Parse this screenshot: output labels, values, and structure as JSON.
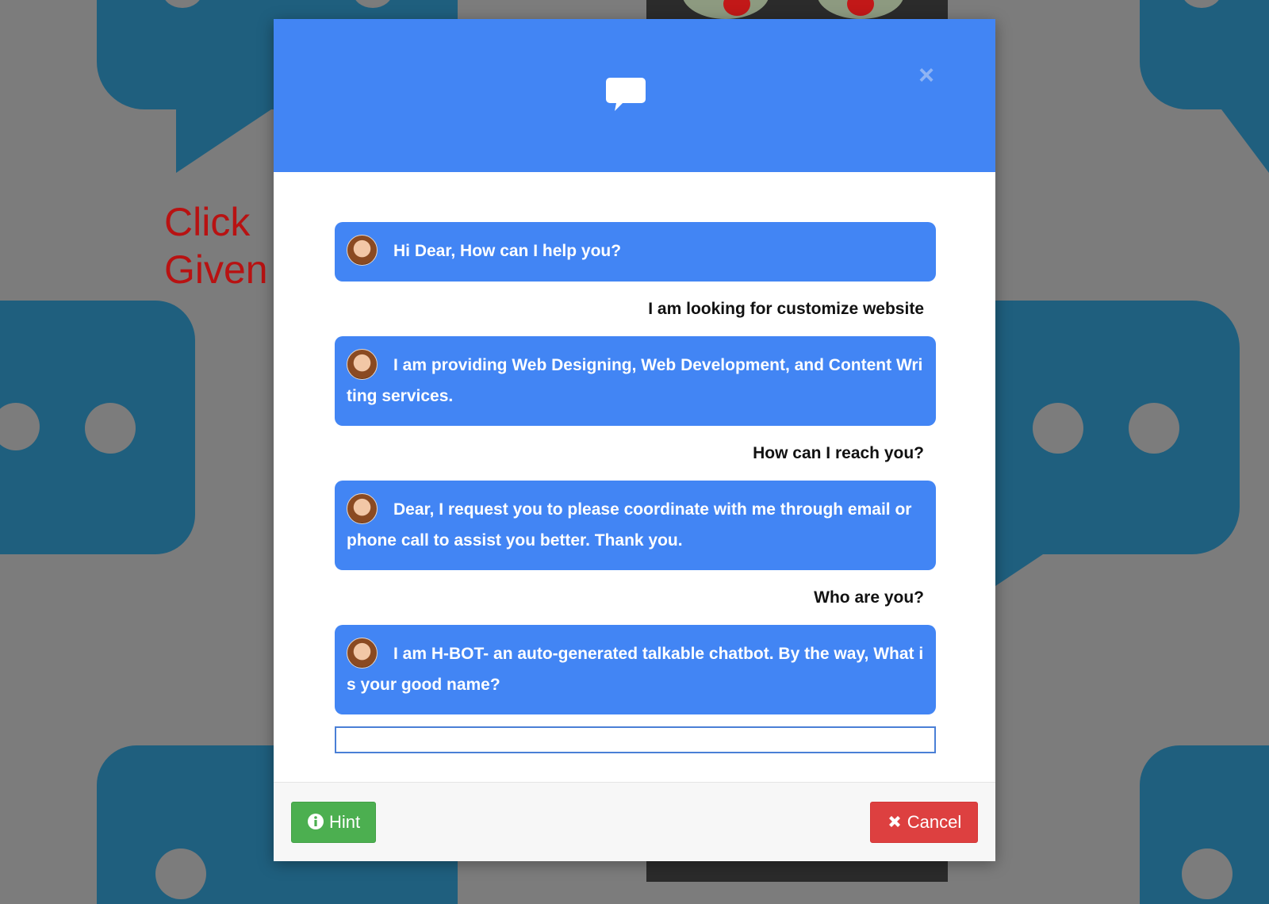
{
  "background": {
    "text": "Click \nGiven"
  },
  "header": {
    "icon": "chat-bubble-icon",
    "close_label": "×"
  },
  "messages": [
    {
      "sender": "bot",
      "text": "Hi Dear, How can I help you?"
    },
    {
      "sender": "user",
      "text": "I am looking for customize website"
    },
    {
      "sender": "bot",
      "text": "I am providing Web Designing, Web Development, and Content Writing services."
    },
    {
      "sender": "user",
      "text": "How can I reach you?"
    },
    {
      "sender": "bot",
      "text": "Dear, I request you to please coordinate with me through email or phone call to assist you better. Thank you."
    },
    {
      "sender": "user",
      "text": "Who are you?"
    },
    {
      "sender": "bot",
      "text": "I am H-BOT- an auto-generated talkable chatbot. By the way, What is your good name?"
    }
  ],
  "input": {
    "value": "",
    "placeholder": ""
  },
  "footer": {
    "hint_label": "Hint",
    "hint_icon": "info-circle-icon",
    "cancel_label": "Cancel",
    "cancel_icon": "times-icon"
  },
  "colors": {
    "primary": "#4285f4",
    "hint": "#4caf50",
    "cancel": "#dd4040",
    "background": "#7c7c7c"
  }
}
